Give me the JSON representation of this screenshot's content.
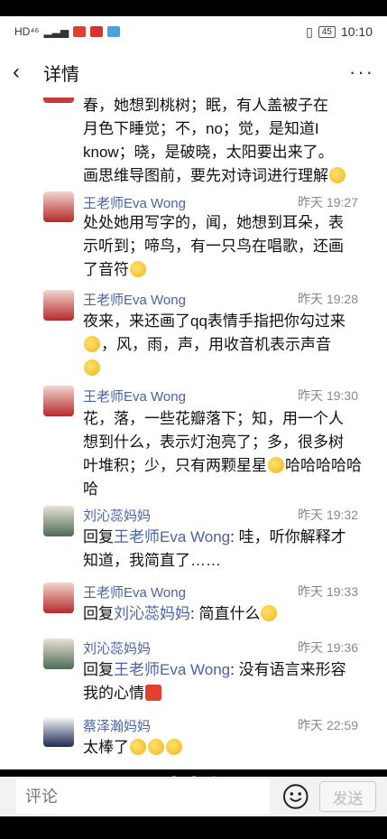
{
  "status_bar": {
    "left_indicators": "HD⁴⁶",
    "battery": "45",
    "time": "10:10"
  },
  "header": {
    "back_icon": "chevron-left-icon",
    "title": "详情",
    "more_label": "···"
  },
  "messages": [
    {
      "name": "",
      "time": "",
      "text_lines": [
        "春，她想到桃树；眠，有人盖被子在",
        "月色下睡觉；不，no；觉，是知道I",
        "know；晓，是破晓，太阳要出来了。",
        "画思维导图前，要先对诗词进行理解"
      ]
    },
    {
      "name": "王老师Eva Wong",
      "time": "昨天 19:27",
      "text_lines": [
        "处处她用写字的，闻，她想到耳朵，表",
        "示听到；啼鸟，有一只鸟在唱歌，还画",
        "了音符"
      ]
    },
    {
      "name": "王老师Eva Wong",
      "time": "昨天 19:28",
      "text_lines": [
        "夜来，来还画了qq表情手指把你勾过来",
        "，风，雨，声，用收音机表示声音",
        ""
      ]
    },
    {
      "name": "王老师Eva Wong",
      "time": "昨天 19:30",
      "text_lines": [
        "花，落，一些花瓣落下；知，用一个人",
        "想到什么，表示灯泡亮了；多，很多树",
        "叶堆积；少，只有两颗星星",
        "哈哈哈哈哈哈"
      ]
    },
    {
      "name": "刘沁蕊妈妈",
      "time": "昨天 19:32",
      "reply_prefix": "回复",
      "reply_to": "王老师Eva Wong",
      "text_lines": [
        ": 哇，听你解释才",
        "知道，我简直了……"
      ]
    },
    {
      "name": "王老师Eva Wong",
      "time": "昨天 19:33",
      "reply_prefix": "回复",
      "reply_to": "刘沁蕊妈妈",
      "text_lines": [
        ": 简直什么"
      ]
    },
    {
      "name": "刘沁蕊妈妈",
      "time": "昨天 19:36",
      "reply_prefix": "回复",
      "reply_to": "王老师Eva Wong",
      "text_lines": [
        ": 没有语言来形容",
        "我的心情"
      ]
    },
    {
      "name": "蔡泽瀚妈妈",
      "time": "昨天 22:59",
      "text_lines": [
        "太棒了"
      ]
    }
  ],
  "input_bar": {
    "placeholder": "评论",
    "send_label": "发送",
    "emoji_icon": "smiley-face-icon"
  },
  "colors": {
    "name_blue": "#4a63a4",
    "time_gray": "#888888"
  }
}
